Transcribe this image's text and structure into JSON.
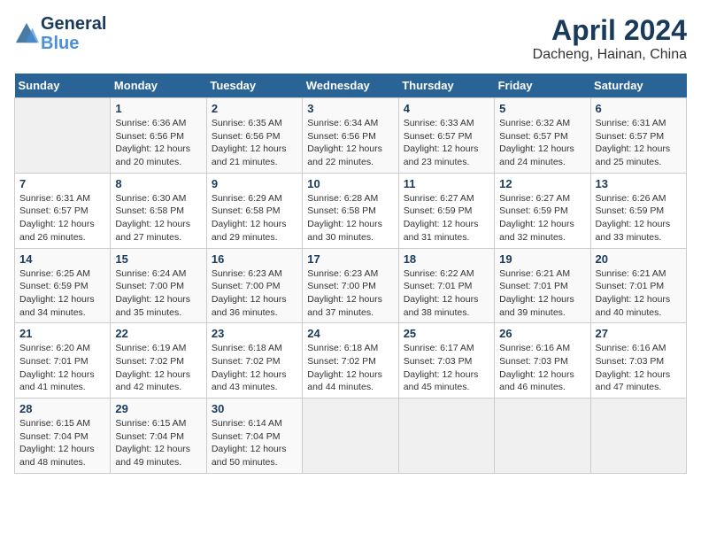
{
  "header": {
    "logo_line1": "General",
    "logo_line2": "Blue",
    "title": "April 2024",
    "subtitle": "Dacheng, Hainan, China"
  },
  "calendar": {
    "days_of_week": [
      "Sunday",
      "Monday",
      "Tuesday",
      "Wednesday",
      "Thursday",
      "Friday",
      "Saturday"
    ],
    "weeks": [
      [
        {
          "num": "",
          "info": ""
        },
        {
          "num": "1",
          "info": "Sunrise: 6:36 AM\nSunset: 6:56 PM\nDaylight: 12 hours\nand 20 minutes."
        },
        {
          "num": "2",
          "info": "Sunrise: 6:35 AM\nSunset: 6:56 PM\nDaylight: 12 hours\nand 21 minutes."
        },
        {
          "num": "3",
          "info": "Sunrise: 6:34 AM\nSunset: 6:56 PM\nDaylight: 12 hours\nand 22 minutes."
        },
        {
          "num": "4",
          "info": "Sunrise: 6:33 AM\nSunset: 6:57 PM\nDaylight: 12 hours\nand 23 minutes."
        },
        {
          "num": "5",
          "info": "Sunrise: 6:32 AM\nSunset: 6:57 PM\nDaylight: 12 hours\nand 24 minutes."
        },
        {
          "num": "6",
          "info": "Sunrise: 6:31 AM\nSunset: 6:57 PM\nDaylight: 12 hours\nand 25 minutes."
        }
      ],
      [
        {
          "num": "7",
          "info": "Sunrise: 6:31 AM\nSunset: 6:57 PM\nDaylight: 12 hours\nand 26 minutes."
        },
        {
          "num": "8",
          "info": "Sunrise: 6:30 AM\nSunset: 6:58 PM\nDaylight: 12 hours\nand 27 minutes."
        },
        {
          "num": "9",
          "info": "Sunrise: 6:29 AM\nSunset: 6:58 PM\nDaylight: 12 hours\nand 29 minutes."
        },
        {
          "num": "10",
          "info": "Sunrise: 6:28 AM\nSunset: 6:58 PM\nDaylight: 12 hours\nand 30 minutes."
        },
        {
          "num": "11",
          "info": "Sunrise: 6:27 AM\nSunset: 6:59 PM\nDaylight: 12 hours\nand 31 minutes."
        },
        {
          "num": "12",
          "info": "Sunrise: 6:27 AM\nSunset: 6:59 PM\nDaylight: 12 hours\nand 32 minutes."
        },
        {
          "num": "13",
          "info": "Sunrise: 6:26 AM\nSunset: 6:59 PM\nDaylight: 12 hours\nand 33 minutes."
        }
      ],
      [
        {
          "num": "14",
          "info": "Sunrise: 6:25 AM\nSunset: 6:59 PM\nDaylight: 12 hours\nand 34 minutes."
        },
        {
          "num": "15",
          "info": "Sunrise: 6:24 AM\nSunset: 7:00 PM\nDaylight: 12 hours\nand 35 minutes."
        },
        {
          "num": "16",
          "info": "Sunrise: 6:23 AM\nSunset: 7:00 PM\nDaylight: 12 hours\nand 36 minutes."
        },
        {
          "num": "17",
          "info": "Sunrise: 6:23 AM\nSunset: 7:00 PM\nDaylight: 12 hours\nand 37 minutes."
        },
        {
          "num": "18",
          "info": "Sunrise: 6:22 AM\nSunset: 7:01 PM\nDaylight: 12 hours\nand 38 minutes."
        },
        {
          "num": "19",
          "info": "Sunrise: 6:21 AM\nSunset: 7:01 PM\nDaylight: 12 hours\nand 39 minutes."
        },
        {
          "num": "20",
          "info": "Sunrise: 6:21 AM\nSunset: 7:01 PM\nDaylight: 12 hours\nand 40 minutes."
        }
      ],
      [
        {
          "num": "21",
          "info": "Sunrise: 6:20 AM\nSunset: 7:01 PM\nDaylight: 12 hours\nand 41 minutes."
        },
        {
          "num": "22",
          "info": "Sunrise: 6:19 AM\nSunset: 7:02 PM\nDaylight: 12 hours\nand 42 minutes."
        },
        {
          "num": "23",
          "info": "Sunrise: 6:18 AM\nSunset: 7:02 PM\nDaylight: 12 hours\nand 43 minutes."
        },
        {
          "num": "24",
          "info": "Sunrise: 6:18 AM\nSunset: 7:02 PM\nDaylight: 12 hours\nand 44 minutes."
        },
        {
          "num": "25",
          "info": "Sunrise: 6:17 AM\nSunset: 7:03 PM\nDaylight: 12 hours\nand 45 minutes."
        },
        {
          "num": "26",
          "info": "Sunrise: 6:16 AM\nSunset: 7:03 PM\nDaylight: 12 hours\nand 46 minutes."
        },
        {
          "num": "27",
          "info": "Sunrise: 6:16 AM\nSunset: 7:03 PM\nDaylight: 12 hours\nand 47 minutes."
        }
      ],
      [
        {
          "num": "28",
          "info": "Sunrise: 6:15 AM\nSunset: 7:04 PM\nDaylight: 12 hours\nand 48 minutes."
        },
        {
          "num": "29",
          "info": "Sunrise: 6:15 AM\nSunset: 7:04 PM\nDaylight: 12 hours\nand 49 minutes."
        },
        {
          "num": "30",
          "info": "Sunrise: 6:14 AM\nSunset: 7:04 PM\nDaylight: 12 hours\nand 50 minutes."
        },
        {
          "num": "",
          "info": ""
        },
        {
          "num": "",
          "info": ""
        },
        {
          "num": "",
          "info": ""
        },
        {
          "num": "",
          "info": ""
        }
      ]
    ]
  }
}
